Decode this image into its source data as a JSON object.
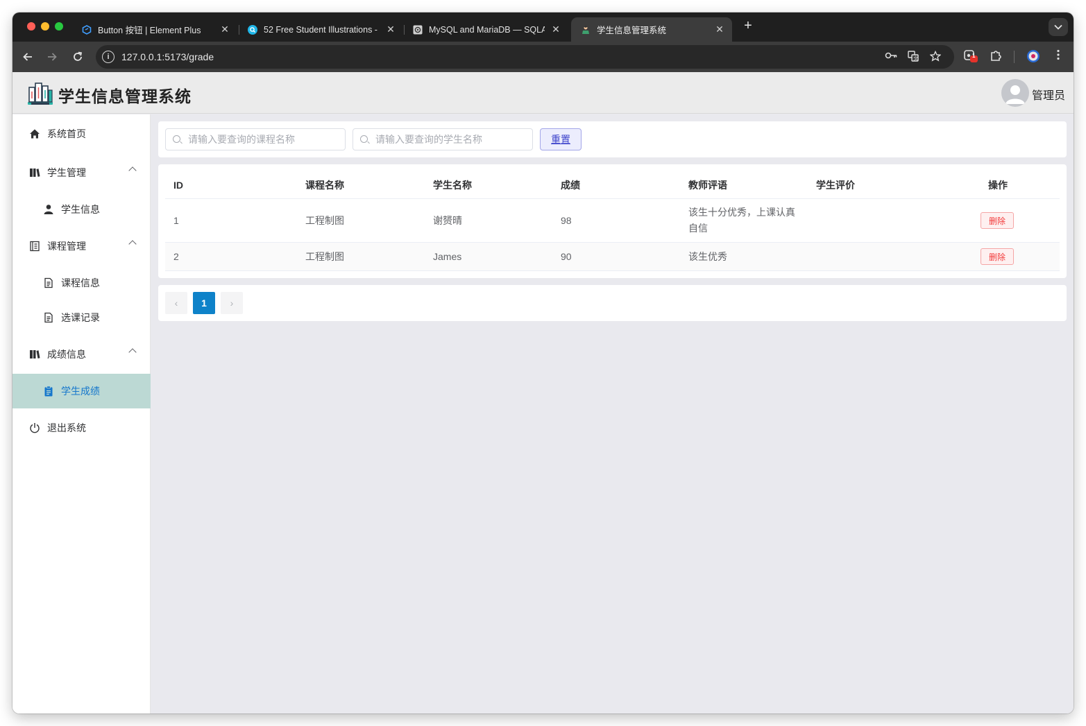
{
  "browser": {
    "tabs": [
      {
        "title": "Button 按钮 | Element Plus",
        "icon": "element-plus-icon"
      },
      {
        "title": "52 Free Student Illustrations -",
        "icon": "search-icon"
      },
      {
        "title": "MySQL and MariaDB — SQLAlc",
        "icon": "sqlalchemy-icon"
      },
      {
        "title": "学生信息管理系统",
        "icon": "student-icon",
        "active": true
      }
    ],
    "new_tab": "+",
    "url": "127.0.0.1:5173/grade",
    "extension_badge": "1"
  },
  "app": {
    "title": "学生信息管理系统",
    "user": "管理员"
  },
  "sidebar": {
    "items": [
      {
        "label": "系统首页",
        "icon": "home-icon",
        "level": 1
      },
      {
        "label": "学生管理",
        "icon": "book-icon",
        "level": 1,
        "expanded": true
      },
      {
        "label": "学生信息",
        "icon": "user-icon",
        "level": 2
      },
      {
        "label": "课程管理",
        "icon": "notebook-icon",
        "level": 1,
        "expanded": true
      },
      {
        "label": "课程信息",
        "icon": "document-icon",
        "level": 2
      },
      {
        "label": "选课记录",
        "icon": "document-icon",
        "level": 2
      },
      {
        "label": "成绩信息",
        "icon": "book-icon",
        "level": 1,
        "expanded": true
      },
      {
        "label": "学生成绩",
        "icon": "clipboard-icon",
        "level": 2,
        "active": true
      },
      {
        "label": "退出系统",
        "icon": "power-icon",
        "level": 1
      }
    ]
  },
  "search": {
    "course_placeholder": "请输入要查询的课程名称",
    "student_placeholder": "请输入要查询的学生名称",
    "reset_label": "重置"
  },
  "table": {
    "columns": [
      "ID",
      "课程名称",
      "学生名称",
      "成绩",
      "教师评语",
      "学生评价",
      "操作"
    ],
    "rows": [
      {
        "id": "1",
        "course": "工程制图",
        "student": "谢赟晴",
        "score": "98",
        "teacher_comment": "该生十分优秀，上课认真自信",
        "student_review": "",
        "action": "删除"
      },
      {
        "id": "2",
        "course": "工程制图",
        "student": "James",
        "score": "90",
        "teacher_comment": "该生优秀",
        "student_review": "",
        "action": "删除"
      }
    ]
  },
  "pagination": {
    "current_page": "1",
    "prev": "‹",
    "next": "›"
  },
  "colors": {
    "accent": "#0e82c9",
    "menu_active_bg": "#bcd9d4",
    "danger": "#f23c3c"
  }
}
